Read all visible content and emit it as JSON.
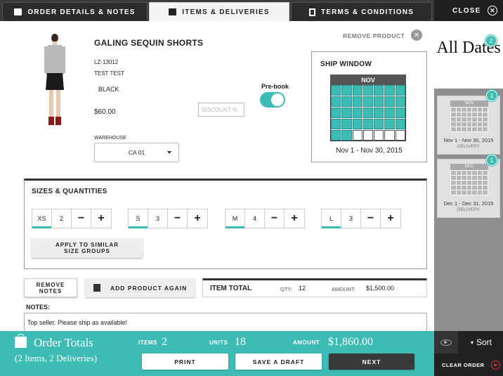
{
  "tabs": [
    {
      "label": "ORDER DETAILS & NOTES",
      "icon": "box-icon"
    },
    {
      "label": "ITEMS & DELIVERIES",
      "icon": "box-icon"
    },
    {
      "label": "TERMS & CONDITIONS",
      "icon": "document-icon"
    }
  ],
  "active_tab": "ITEMS & DELIVERIES",
  "close": {
    "label": "CLOSE"
  },
  "sidebar": {
    "all_dates": "All Dates",
    "all_dates_badge": "2",
    "deliveries": [
      {
        "month": "NOV",
        "range": "Nov 1 - Nov 30, 2015",
        "label": "DELIVERY",
        "badge": "1"
      },
      {
        "month": "DEC",
        "range": "Dec 1 - Dec 31, 2015",
        "label": "DELIVERY",
        "badge": "1"
      }
    ],
    "sort_label": "Sort",
    "clear_order": "CLEAR ORDER"
  },
  "product": {
    "name": "GALING SEQUIN SHORTS",
    "sku": "LZ-13012",
    "description": "TEST TEST",
    "color": "BLACK",
    "price": "$60.00",
    "discount_placeholder": "DISCOUNT %",
    "prebook_label": "Pre-book",
    "prebook_on": true,
    "warehouse_label": "WAREHOUSE",
    "warehouse_value": "CA 01",
    "remove_label": "REMOVE PRODUCT"
  },
  "ship_window": {
    "title": "SHIP WINDOW",
    "month": "NOV",
    "range": "Nov 1 - Nov 30, 2015"
  },
  "sizes": {
    "title": "SIZES & QUANTITIES",
    "items": [
      {
        "size": "XS",
        "qty": "2"
      },
      {
        "size": "S",
        "qty": "3"
      },
      {
        "size": "M",
        "qty": "4"
      },
      {
        "size": "L",
        "qty": "3"
      }
    ],
    "minus": "−",
    "plus": "+",
    "apply_label_1": "APPLY TO SIMILAR",
    "apply_label_2": "SIZE GROUPS"
  },
  "actions": {
    "remove_notes_1": "REMOVE",
    "remove_notes_2": "NOTES",
    "add_again": "ADD PRODUCT AGAIN"
  },
  "item_total": {
    "label": "ITEM TOTAL",
    "qty_label": "QTY:",
    "qty": "12",
    "amount_label": "AMOUNT:",
    "amount": "$1,500.00"
  },
  "notes": {
    "label": "NOTES:",
    "text": "Top seller. Please ship as available!"
  },
  "footer": {
    "title": "Order Totals",
    "subtitle": "(2 Items, 2 Deliveries)",
    "items_label": "ITEMS",
    "items_value": "2",
    "units_label": "UNITS",
    "units_value": "18",
    "amount_label": "AMOUNT",
    "amount_value": "$1,860.00",
    "print": "PRINT",
    "save_draft": "SAVE A DRAFT",
    "next": "NEXT"
  },
  "colors": {
    "accent": "#3cbcb4",
    "dark": "#2b2b2b",
    "danger": "#d9302c"
  }
}
